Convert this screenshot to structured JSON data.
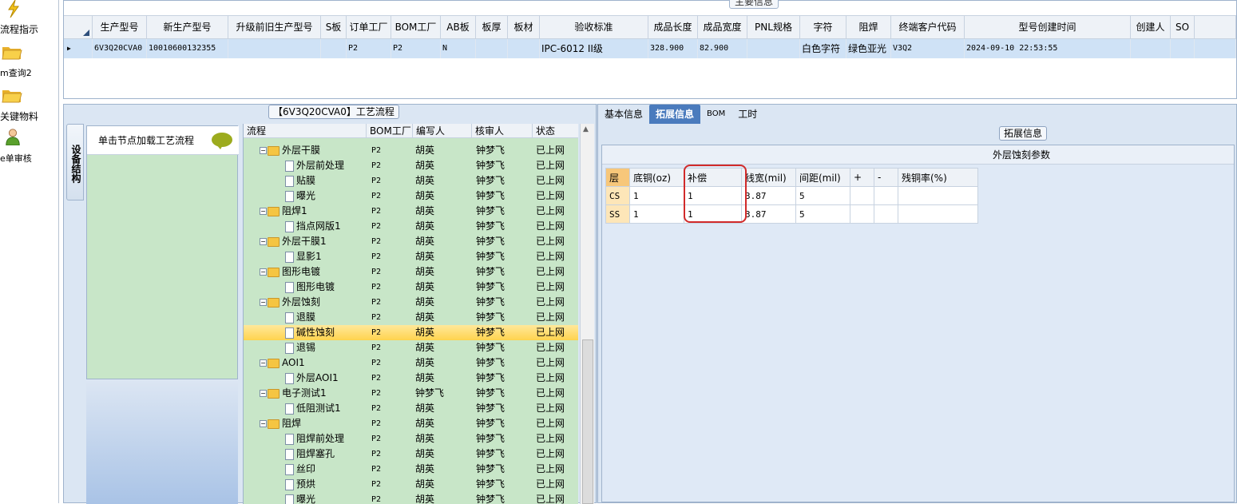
{
  "nav": {
    "items": [
      {
        "label": "流程指示",
        "icon": "lightning-icon"
      },
      {
        "label": "m查询2",
        "icon": "folder-open-icon"
      },
      {
        "label": "关键物料",
        "icon": "folder-open-icon"
      },
      {
        "label": "e单审核",
        "icon": "user-icon"
      }
    ]
  },
  "main": {
    "title": "主要信息",
    "columns": [
      "生产型号",
      "新生产型号",
      "升级前旧生产型号",
      "S板",
      "订单工厂",
      "BOM工厂",
      "AB板",
      "板厚",
      "板材",
      "验收标准",
      "成品长度",
      "成品宽度",
      "PNL规格",
      "字符",
      "阻焊",
      "终端客户代码",
      "型号创建时间",
      "创建人",
      "SO"
    ],
    "row": [
      "6V3Q20CVA0",
      "10010600132355",
      "",
      "",
      "P2",
      "P2",
      "N",
      "",
      "",
      "IPC-6012 II级",
      "328.900",
      "82.900",
      "",
      "白色字符",
      "绿色亚光",
      "V3Q2",
      "2024-09-10 22:53:55",
      "",
      ""
    ]
  },
  "process": {
    "title": "【6V3Q20CVA0】工艺流程",
    "side_tab": "设备结构",
    "load_hint": "单击节点加载工艺流程",
    "headers": [
      "流程",
      "BOM工厂",
      "编写人",
      "核审人",
      "状态"
    ],
    "rows": [
      {
        "name": "外层干膜",
        "type": "folder",
        "bom": "P2",
        "writer": "胡英",
        "reviewer": "钟梦飞",
        "status": "已上网"
      },
      {
        "name": "外层前处理",
        "type": "doc",
        "bom": "P2",
        "writer": "胡英",
        "reviewer": "钟梦飞",
        "status": "已上网"
      },
      {
        "name": "贴膜",
        "type": "doc",
        "bom": "P2",
        "writer": "胡英",
        "reviewer": "钟梦飞",
        "status": "已上网"
      },
      {
        "name": "曝光",
        "type": "doc",
        "bom": "P2",
        "writer": "胡英",
        "reviewer": "钟梦飞",
        "status": "已上网"
      },
      {
        "name": "阻焊1",
        "type": "folder",
        "bom": "P2",
        "writer": "胡英",
        "reviewer": "钟梦飞",
        "status": "已上网"
      },
      {
        "name": "挡点网版1",
        "type": "doc",
        "bom": "P2",
        "writer": "胡英",
        "reviewer": "钟梦飞",
        "status": "已上网"
      },
      {
        "name": "外层干膜1",
        "type": "folder",
        "bom": "P2",
        "writer": "胡英",
        "reviewer": "钟梦飞",
        "status": "已上网"
      },
      {
        "name": "显影1",
        "type": "doc",
        "bom": "P2",
        "writer": "胡英",
        "reviewer": "钟梦飞",
        "status": "已上网"
      },
      {
        "name": "图形电镀",
        "type": "folder",
        "bom": "P2",
        "writer": "胡英",
        "reviewer": "钟梦飞",
        "status": "已上网"
      },
      {
        "name": "图形电镀",
        "type": "doc",
        "bom": "P2",
        "writer": "胡英",
        "reviewer": "钟梦飞",
        "status": "已上网"
      },
      {
        "name": "外层蚀刻",
        "type": "folder",
        "bom": "P2",
        "writer": "胡英",
        "reviewer": "钟梦飞",
        "status": "已上网"
      },
      {
        "name": "退膜",
        "type": "doc",
        "bom": "P2",
        "writer": "胡英",
        "reviewer": "钟梦飞",
        "status": "已上网"
      },
      {
        "name": "碱性蚀刻",
        "type": "doc",
        "bom": "P2",
        "writer": "胡英",
        "reviewer": "钟梦飞",
        "status": "已上网",
        "selected": true
      },
      {
        "name": "退锡",
        "type": "doc",
        "bom": "P2",
        "writer": "胡英",
        "reviewer": "钟梦飞",
        "status": "已上网"
      },
      {
        "name": "AOI1",
        "type": "folder",
        "bom": "P2",
        "writer": "胡英",
        "reviewer": "钟梦飞",
        "status": "已上网"
      },
      {
        "name": "外层AOI1",
        "type": "doc",
        "bom": "P2",
        "writer": "胡英",
        "reviewer": "钟梦飞",
        "status": "已上网"
      },
      {
        "name": "电子测试1",
        "type": "folder",
        "bom": "P2",
        "writer": "钟梦飞",
        "reviewer": "钟梦飞",
        "status": "已上网"
      },
      {
        "name": "低阻测试1",
        "type": "doc",
        "bom": "P2",
        "writer": "胡英",
        "reviewer": "钟梦飞",
        "status": "已上网"
      },
      {
        "name": "阻焊",
        "type": "folder",
        "bom": "P2",
        "writer": "胡英",
        "reviewer": "钟梦飞",
        "status": "已上网"
      },
      {
        "name": "阻焊前处理",
        "type": "doc",
        "bom": "P2",
        "writer": "胡英",
        "reviewer": "钟梦飞",
        "status": "已上网"
      },
      {
        "name": "阻焊塞孔",
        "type": "doc",
        "bom": "P2",
        "writer": "胡英",
        "reviewer": "钟梦飞",
        "status": "已上网"
      },
      {
        "name": "丝印",
        "type": "doc",
        "bom": "P2",
        "writer": "胡英",
        "reviewer": "钟梦飞",
        "status": "已上网"
      },
      {
        "name": "预烘",
        "type": "doc",
        "bom": "P2",
        "writer": "胡英",
        "reviewer": "钟梦飞",
        "status": "已上网"
      },
      {
        "name": "曝光",
        "type": "doc",
        "bom": "P2",
        "writer": "胡英",
        "reviewer": "钟梦飞",
        "status": "已上网"
      }
    ]
  },
  "detail": {
    "tabs": [
      "基本信息",
      "拓展信息",
      "BOM",
      "工时"
    ],
    "active_tab": "拓展信息",
    "section_title": "拓展信息",
    "table_title": "外层蚀刻参数",
    "headers": [
      "层",
      "底铜(oz)",
      "补偿",
      "线宽(mil)",
      "间距(mil)",
      "+",
      "-",
      "残铜率(%)"
    ],
    "rows": [
      [
        "CS",
        "1",
        "1",
        "3.87",
        "5",
        "",
        "",
        ""
      ],
      [
        "SS",
        "1",
        "1",
        "3.87",
        "5",
        "",
        "",
        ""
      ]
    ],
    "highlight_color": "#d12a2a"
  }
}
